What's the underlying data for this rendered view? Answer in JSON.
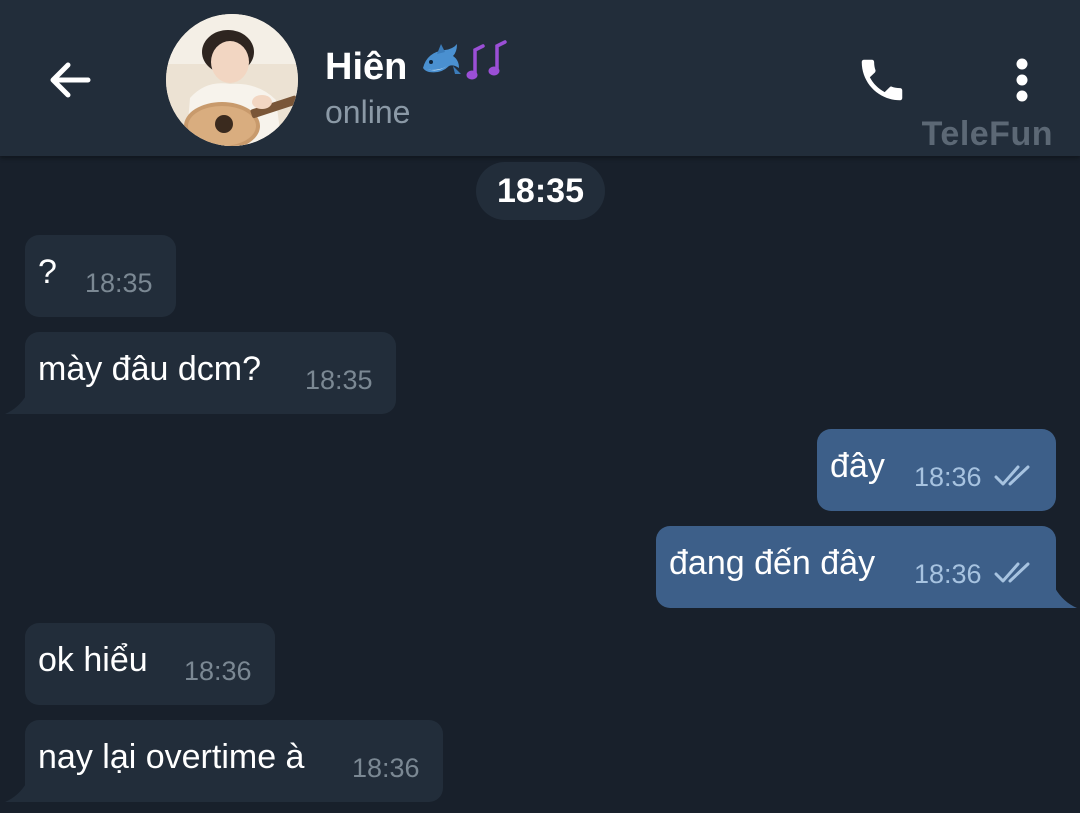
{
  "header": {
    "back_icon": "arrow-left-icon",
    "contact_name": "Hiên",
    "name_emojis": [
      "dolphin-icon",
      "music-notes-icon"
    ],
    "status": "online",
    "call_icon": "phone-icon",
    "menu_icon": "more-vertical-icon",
    "watermark": "TeleFun"
  },
  "chat": {
    "date_chip": "18:35",
    "messages": [
      {
        "direction": "incoming",
        "text": "?",
        "time": "18:35"
      },
      {
        "direction": "incoming",
        "text": "mày đâu dcm?",
        "time": "18:35"
      },
      {
        "direction": "outgoing",
        "text": "đây",
        "time": "18:36",
        "status_icon": "double-check-icon"
      },
      {
        "direction": "outgoing",
        "text": "đang đến đây",
        "time": "18:36",
        "status_icon": "double-check-icon"
      },
      {
        "direction": "incoming",
        "text": "ok hiểu",
        "time": "18:36"
      },
      {
        "direction": "incoming",
        "text": "nay lại overtime à",
        "time": "18:36"
      }
    ]
  },
  "colors": {
    "background": "#18202b",
    "header": "#222d3a",
    "incoming_bubble": "#222d3a",
    "outgoing_bubble": "#3d5f89",
    "outgoing_time": "#a7c3e0"
  }
}
